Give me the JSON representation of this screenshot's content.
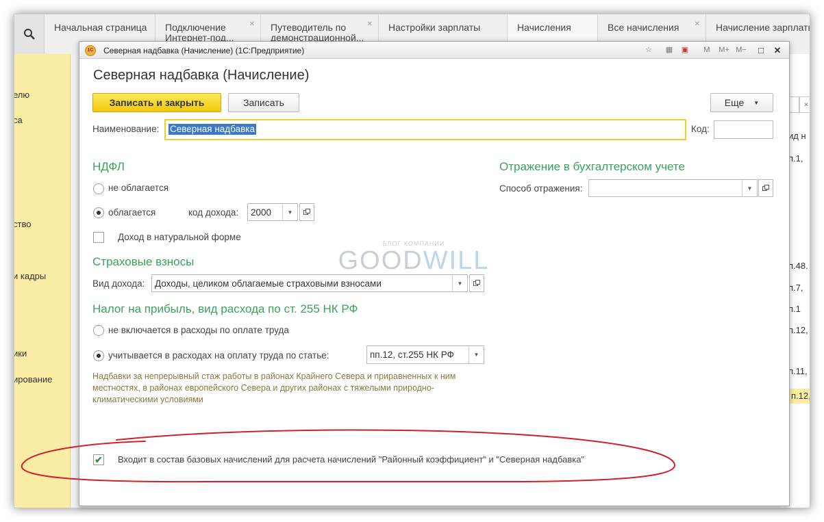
{
  "tabs": [
    {
      "label": "Начальная страница",
      "closable": false
    },
    {
      "label": "Подключение Интернет-под...",
      "closable": true
    },
    {
      "label": "Путеводитель по демонстрационной...",
      "closable": true
    },
    {
      "label": "Настройки зарплаты",
      "closable": false
    },
    {
      "label": "Начисления",
      "closable": false
    },
    {
      "label": "Все начисления",
      "closable": true
    },
    {
      "label": "Начисление зарплаты",
      "closable": false
    }
  ],
  "sidebar": {
    "items": [
      "елю",
      "са",
      "ство",
      "и кадры",
      "ики",
      "ирование"
    ]
  },
  "bg_list": {
    "header": "ид н",
    "rows": [
      "п.1,",
      "п.48.",
      "п.7,",
      "п.1",
      "п.12,",
      "п.11,",
      "п.12,"
    ]
  },
  "dialog": {
    "window_title": "Северная надбавка (Начисление) (1С:Предприятие)",
    "titlebar_buttons": [
      "M",
      "M+",
      "M−"
    ],
    "form_title": "Северная надбавка (Начисление)",
    "save_close_label": "Записать и закрыть",
    "save_label": "Записать",
    "more_label": "Еще",
    "name_label": "Наименование:",
    "name_value": "Северная надбавка",
    "code_label": "Код:",
    "code_value": ""
  },
  "ndfl": {
    "title": "НДФЛ",
    "not_taxed_label": "не облагается",
    "taxed_label": "облагается",
    "selected": "taxed",
    "income_code_label": "код дохода:",
    "income_code_value": "2000",
    "natural_income_label": "Доход в натуральной форме",
    "natural_income_checked": false
  },
  "accounting": {
    "title": "Отражение в бухгалтерском учете",
    "method_label": "Способ отражения:",
    "method_value": ""
  },
  "insurance": {
    "title": "Страховые взносы",
    "income_type_label": "Вид дохода:",
    "income_type_value": "Доходы, целиком облагаемые страховыми взносами"
  },
  "profit_tax": {
    "title": "Налог на прибыль, вид расхода по ст. 255 НК РФ",
    "not_included_label": "не включается в расходы по оплате труда",
    "included_label": "учитывается в расходах на оплату труда по статье:",
    "selected": "included",
    "article_value": "пп.12, ст.255 НК РФ",
    "note": "Надбавки за непрерывный стаж работы в районах Крайнего Севера и приравненных к ним местностях, в районах европейского Севера и других районах с тяжелыми природно-климатическими условиями"
  },
  "base_accruals": {
    "label": "Входит в состав базовых начислений для расчета начислений \"Районный коэффициент\" и \"Северная надбавка\"",
    "checked": true
  },
  "watermark": {
    "top": "БЛОГ КОМПАНИИ",
    "main_a": "GOOD",
    "main_b": "WILL",
    "bottom": "ТЕХНОЛОГИИ ДЛЯ БИЗНЕСА"
  },
  "colors": {
    "accent_yellow": "#f2c90e",
    "section_green": "#3aa35a",
    "annotation_red": "#d0202a",
    "sidebar_yellow": "#fbeca6"
  }
}
